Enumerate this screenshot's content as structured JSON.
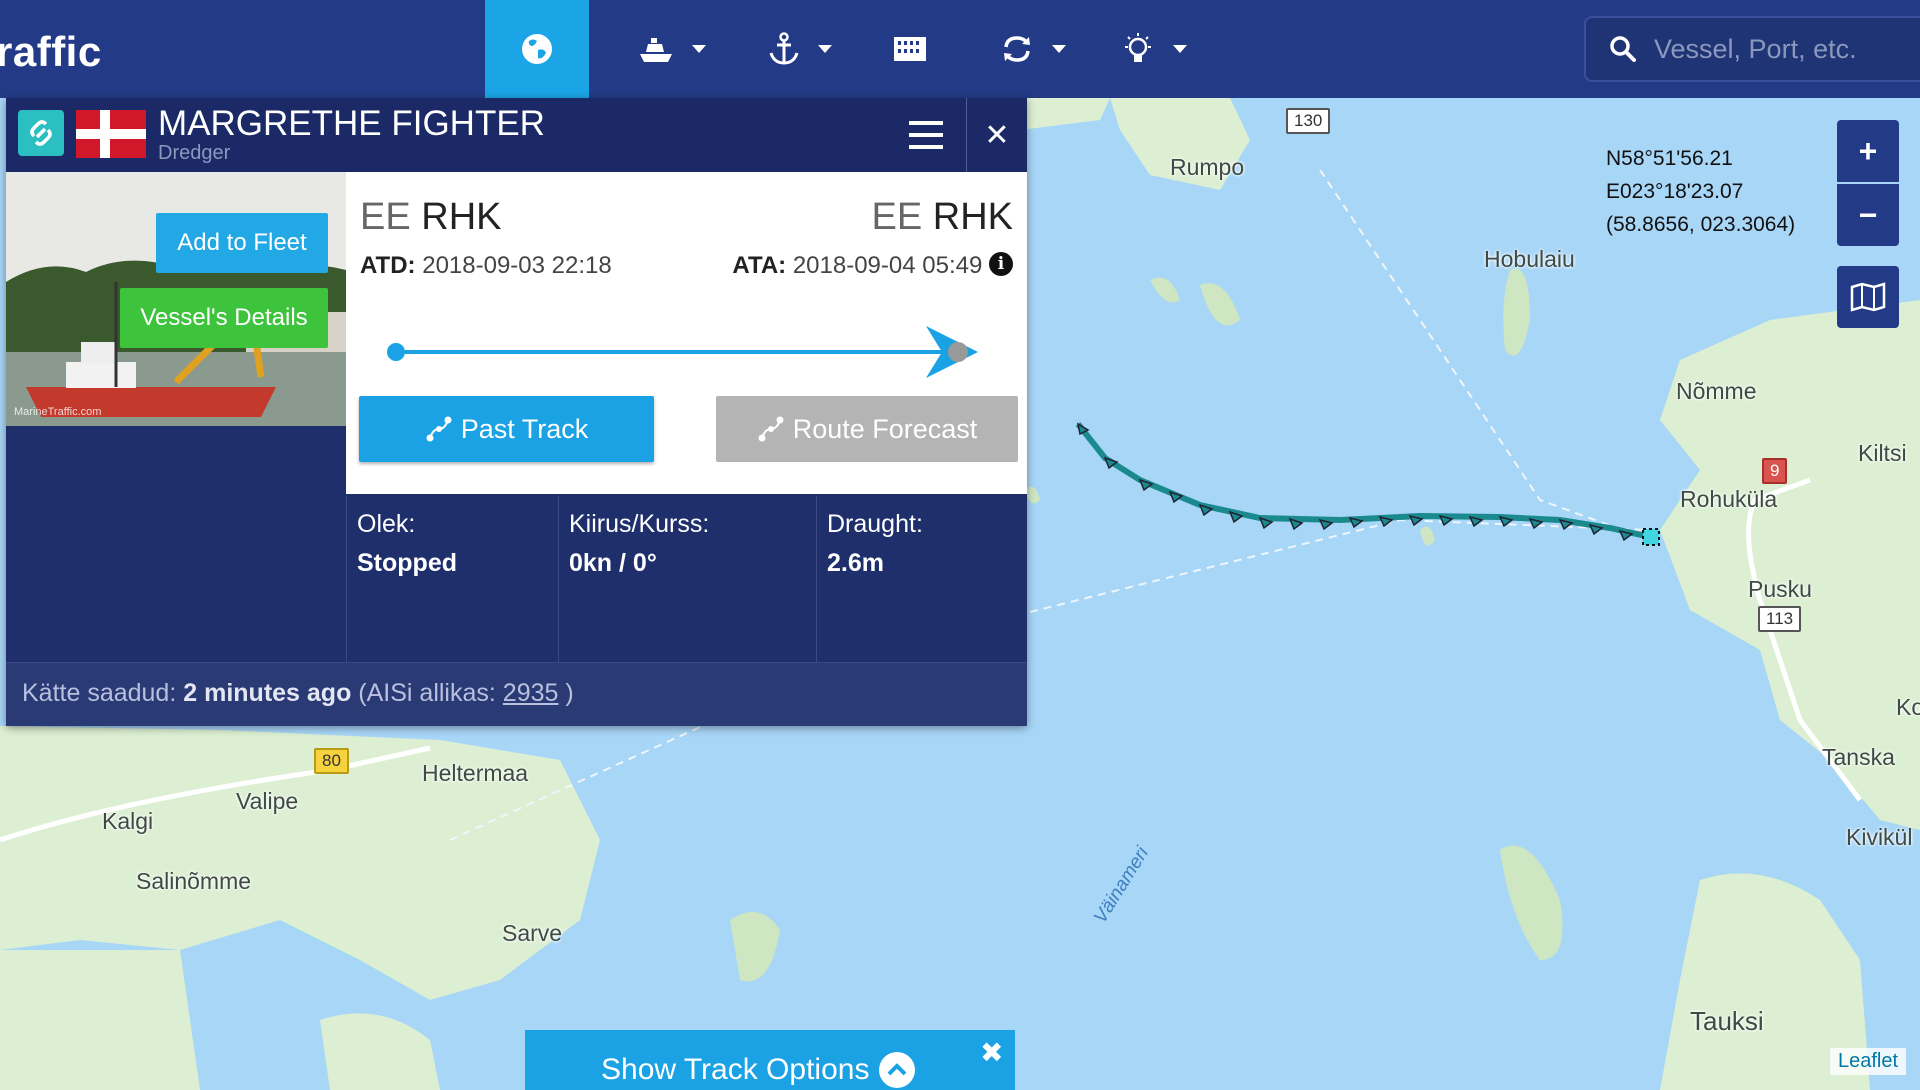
{
  "app": {
    "brand": "raffic"
  },
  "nav": {
    "items": [
      {
        "icon": "globe-icon",
        "active": true
      },
      {
        "icon": "ship-icon",
        "has_dropdown": true
      },
      {
        "icon": "anchor-icon",
        "has_dropdown": true
      },
      {
        "icon": "building-icon",
        "has_dropdown": false
      },
      {
        "icon": "refresh-icon",
        "has_dropdown": true
      },
      {
        "icon": "lightbulb-icon",
        "has_dropdown": true
      }
    ],
    "search_placeholder": "Vessel, Port, etc."
  },
  "map_controls": {
    "zoom_in": "+",
    "zoom_out": "−",
    "layers_icon": "map-icon"
  },
  "coordinates": {
    "lat": "N58°51'56.21",
    "lon": "E023°18'23.07",
    "decimal": "(58.8656, 023.3064)"
  },
  "vessel": {
    "name": "MARGRETHE FIGHTER",
    "type": "Dredger",
    "flag": "Denmark",
    "photo_credit": "MarineTraffic.com",
    "departure": {
      "country": "EE",
      "port": "RHK",
      "time_label": "ATD:",
      "time": "2018-09-03 22:18"
    },
    "arrival": {
      "country": "EE",
      "port": "RHK",
      "time_label": "ATA:",
      "time": "2018-09-04 05:49"
    },
    "progress": 1.0,
    "buttons": {
      "past_track": "Past Track",
      "route_forecast": "Route Forecast",
      "add_to_fleet": "Add to Fleet",
      "vessel_details": "Vessel's Details"
    },
    "stats": [
      {
        "label": "Olek:",
        "value": "Stopped"
      },
      {
        "label": "Kiirus/Kurss:",
        "value": "0kn / 0°"
      },
      {
        "label": "Draught:",
        "value": "2.6m"
      }
    ],
    "received": {
      "label": "Kätte saadud:",
      "ago": "2 minutes ago",
      "source_label": "(AISi allikas:",
      "source_id": "2935",
      "source_close": ")"
    }
  },
  "map_labels": [
    {
      "text": "Rumpo"
    },
    {
      "text": "Hobulaiu"
    },
    {
      "text": "Nõmme"
    },
    {
      "text": "Kiltsi"
    },
    {
      "text": "Rohuküla"
    },
    {
      "text": "Pusku"
    },
    {
      "text": "Ko"
    },
    {
      "text": "Tanska"
    },
    {
      "text": "Kivikül"
    },
    {
      "text": "Tauksi"
    },
    {
      "text": "Heltermaa"
    },
    {
      "text": "Valipe"
    },
    {
      "text": "Kalgi"
    },
    {
      "text": "Salinõmme"
    },
    {
      "text": "Sarve"
    }
  ],
  "water_label": "Väinameri",
  "road_shields": [
    {
      "text": "130",
      "style": "white"
    },
    {
      "text": "9",
      "style": "red"
    },
    {
      "text": "113",
      "style": "white"
    },
    {
      "text": "80",
      "style": "yellow"
    }
  ],
  "track_options": {
    "label": "Show Track Options",
    "close": "✖"
  },
  "attribution": "Leaflet",
  "colors": {
    "nav_bg": "#233b86",
    "nav_active": "#1ba5e6",
    "panel_bg": "#1e2f6b",
    "track": "#1b8a8f",
    "water": "#a8d6f7",
    "land": "#dcefd2"
  }
}
